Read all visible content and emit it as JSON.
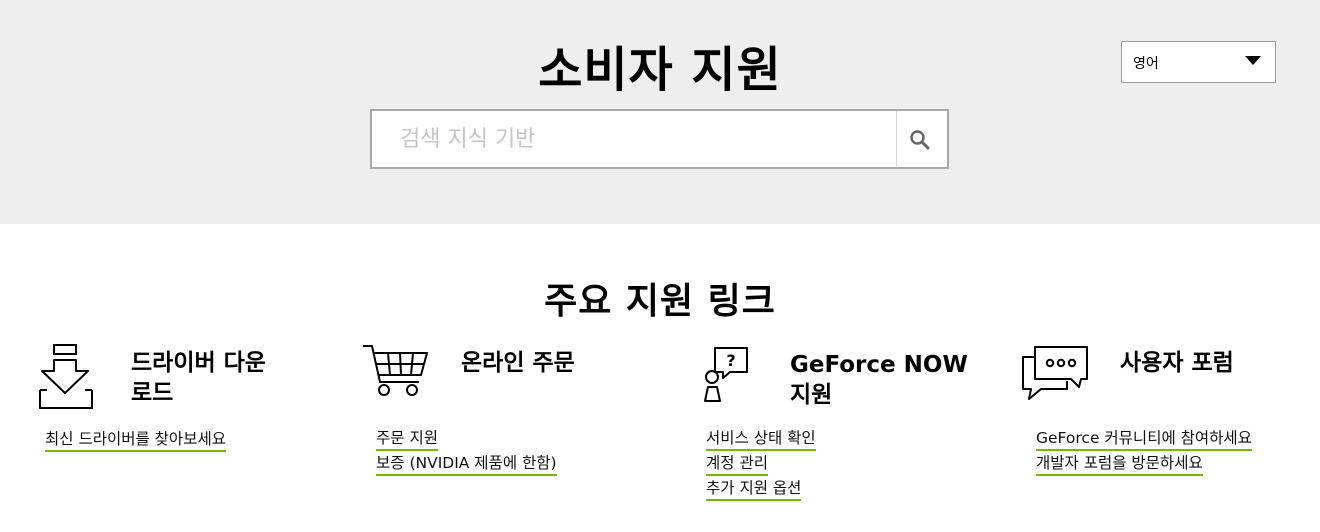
{
  "header": {
    "title": "소비자 지원",
    "language_label": "영어",
    "search": {
      "placeholder": "검색 지식 기반",
      "value": ""
    }
  },
  "section": {
    "title": "주요 지원 링크",
    "accent_color": "#76b900",
    "cards": [
      {
        "icon": "download-icon",
        "title_lines": [
          "드라이버 다운",
          "로드"
        ],
        "links": [
          "최신 드라이버를 찾아보세요"
        ]
      },
      {
        "icon": "cart-icon",
        "title_lines": [
          "온라인 주문"
        ],
        "links": [
          "주문 지원",
          "보증 (NVIDIA 제품에 한함)"
        ]
      },
      {
        "icon": "support-person-icon",
        "title_lines": [
          "GeForce NOW",
          "지원"
        ],
        "links": [
          "서비스 상태 확인",
          "계정 관리",
          "추가 지원 옵션"
        ]
      },
      {
        "icon": "chat-bubbles-icon",
        "title_lines": [
          "사용자 포럼"
        ],
        "links": [
          "GeForce 커뮤니티에 참여하세요",
          "개발자 포럼을 방문하세요"
        ]
      }
    ]
  }
}
